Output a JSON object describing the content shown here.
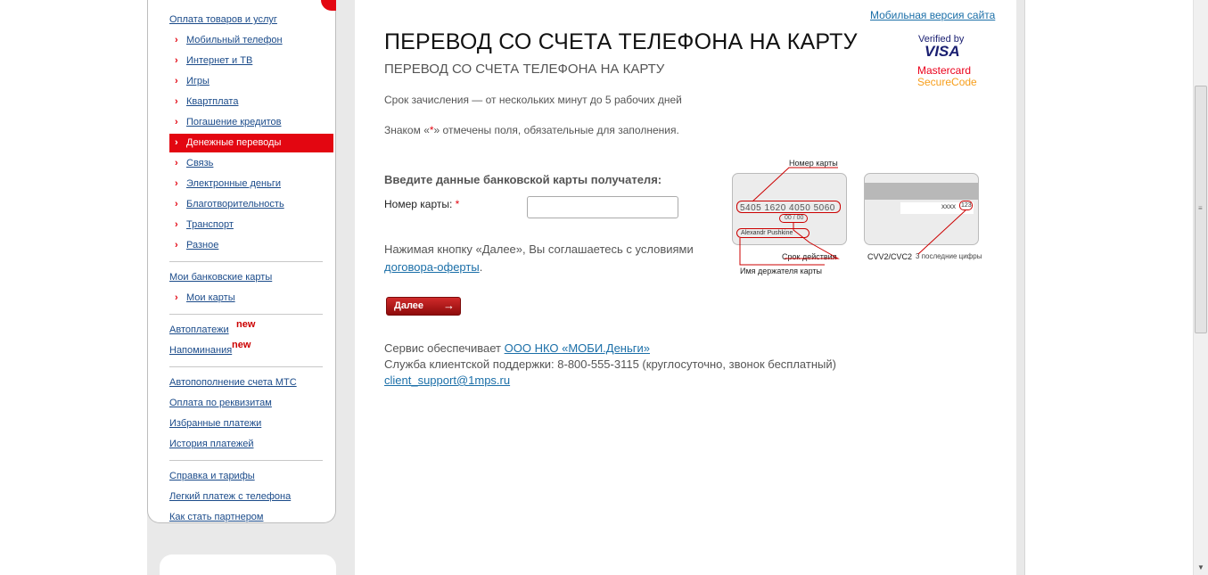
{
  "sidebar": {
    "sections": [
      {
        "title": "Оплата товаров и услуг",
        "items": [
          {
            "label": "Мобильный телефон",
            "active": false
          },
          {
            "label": "Интернет и ТВ",
            "active": false
          },
          {
            "label": "Игры",
            "active": false
          },
          {
            "label": "Квартплата",
            "active": false
          },
          {
            "label": "Погашение кредитов",
            "active": false
          },
          {
            "label": "Денежные переводы",
            "active": true
          },
          {
            "label": "Связь",
            "active": false
          },
          {
            "label": "Электронные деньги",
            "active": false
          },
          {
            "label": "Благотворительность",
            "active": false
          },
          {
            "label": "Транспорт",
            "active": false
          },
          {
            "label": "Разное",
            "active": false
          }
        ]
      },
      {
        "title": "Мои банковские карты",
        "items": [
          {
            "label": "Мои карты",
            "active": false
          }
        ]
      }
    ],
    "autopay_label": "Автоплатежи",
    "reminders_label": "Напоминания",
    "new_badge": "new",
    "links_group_1": [
      "Автопополнение счета МТС",
      "Оплата по реквизитам",
      "Избранные платежи",
      "История платежей"
    ],
    "links_group_2": [
      "Справка и тарифы",
      "Легкий платеж с телефона",
      "Как стать партнером"
    ]
  },
  "header": {
    "mobile_link": "Мобильная версия сайта",
    "title": "ПЕРЕВОД СО СЧЕТА ТЕЛЕФОНА НА КАРТУ",
    "subtitle": "ПЕРЕВОД СО СЧЕТА ТЕЛЕФОНА НА КАРТУ",
    "verified_line1": "Verified by",
    "verified_line2": "VISA",
    "mc_line1": "Mastercard",
    "mc_line2": "SecureCode"
  },
  "info": {
    "term": "Срок зачисления — от нескольких минут до 5 рабочих дней",
    "required_pre": "Знаком «",
    "required_star": "*",
    "required_post": "» отмечены поля, обязательные для заполнения."
  },
  "form": {
    "title": "Введите данные банковской карты получателя:",
    "card_label": "Номер карты:",
    "card_star": "*",
    "card_value": "",
    "agree_text": "Нажимая кнопку «Далее», Вы соглашаетесь с условиями",
    "agree_link": "договора-оферты",
    "agree_end": ".",
    "next_button": "Далее",
    "next_arrow": "→"
  },
  "card_illustration": {
    "number_caption": "Номер карты",
    "number": "5405 1620 4050 5060",
    "expiry": "00 / 00",
    "holder": "Alexandr Pushkine",
    "expiry_caption": "Срок действия",
    "holder_caption": "Имя держателя карты",
    "back_digits": "xxxx",
    "cvv": "123",
    "cvv_caption": "CVV2/CVC2",
    "cvv_hint": "3 последние цифры"
  },
  "footer": {
    "service_pre": "Сервис обеспечивает ",
    "service_link": "ООО НКО «МОБИ.Деньги»",
    "support": "Служба клиентской поддержки: 8-800-555-3115 (круглосуточно, звонок бесплатный)",
    "email": "client_support@1mps.ru"
  },
  "icons": [
    "chevron-right-icon",
    "arrow-right-icon",
    "visa-logo",
    "mastercard-logo",
    "scroll-up-icon",
    "scroll-down-icon"
  ],
  "colors": {
    "accent": "#e30611",
    "link": "#1b6fa8",
    "nav_link": "#1b4b8a"
  }
}
